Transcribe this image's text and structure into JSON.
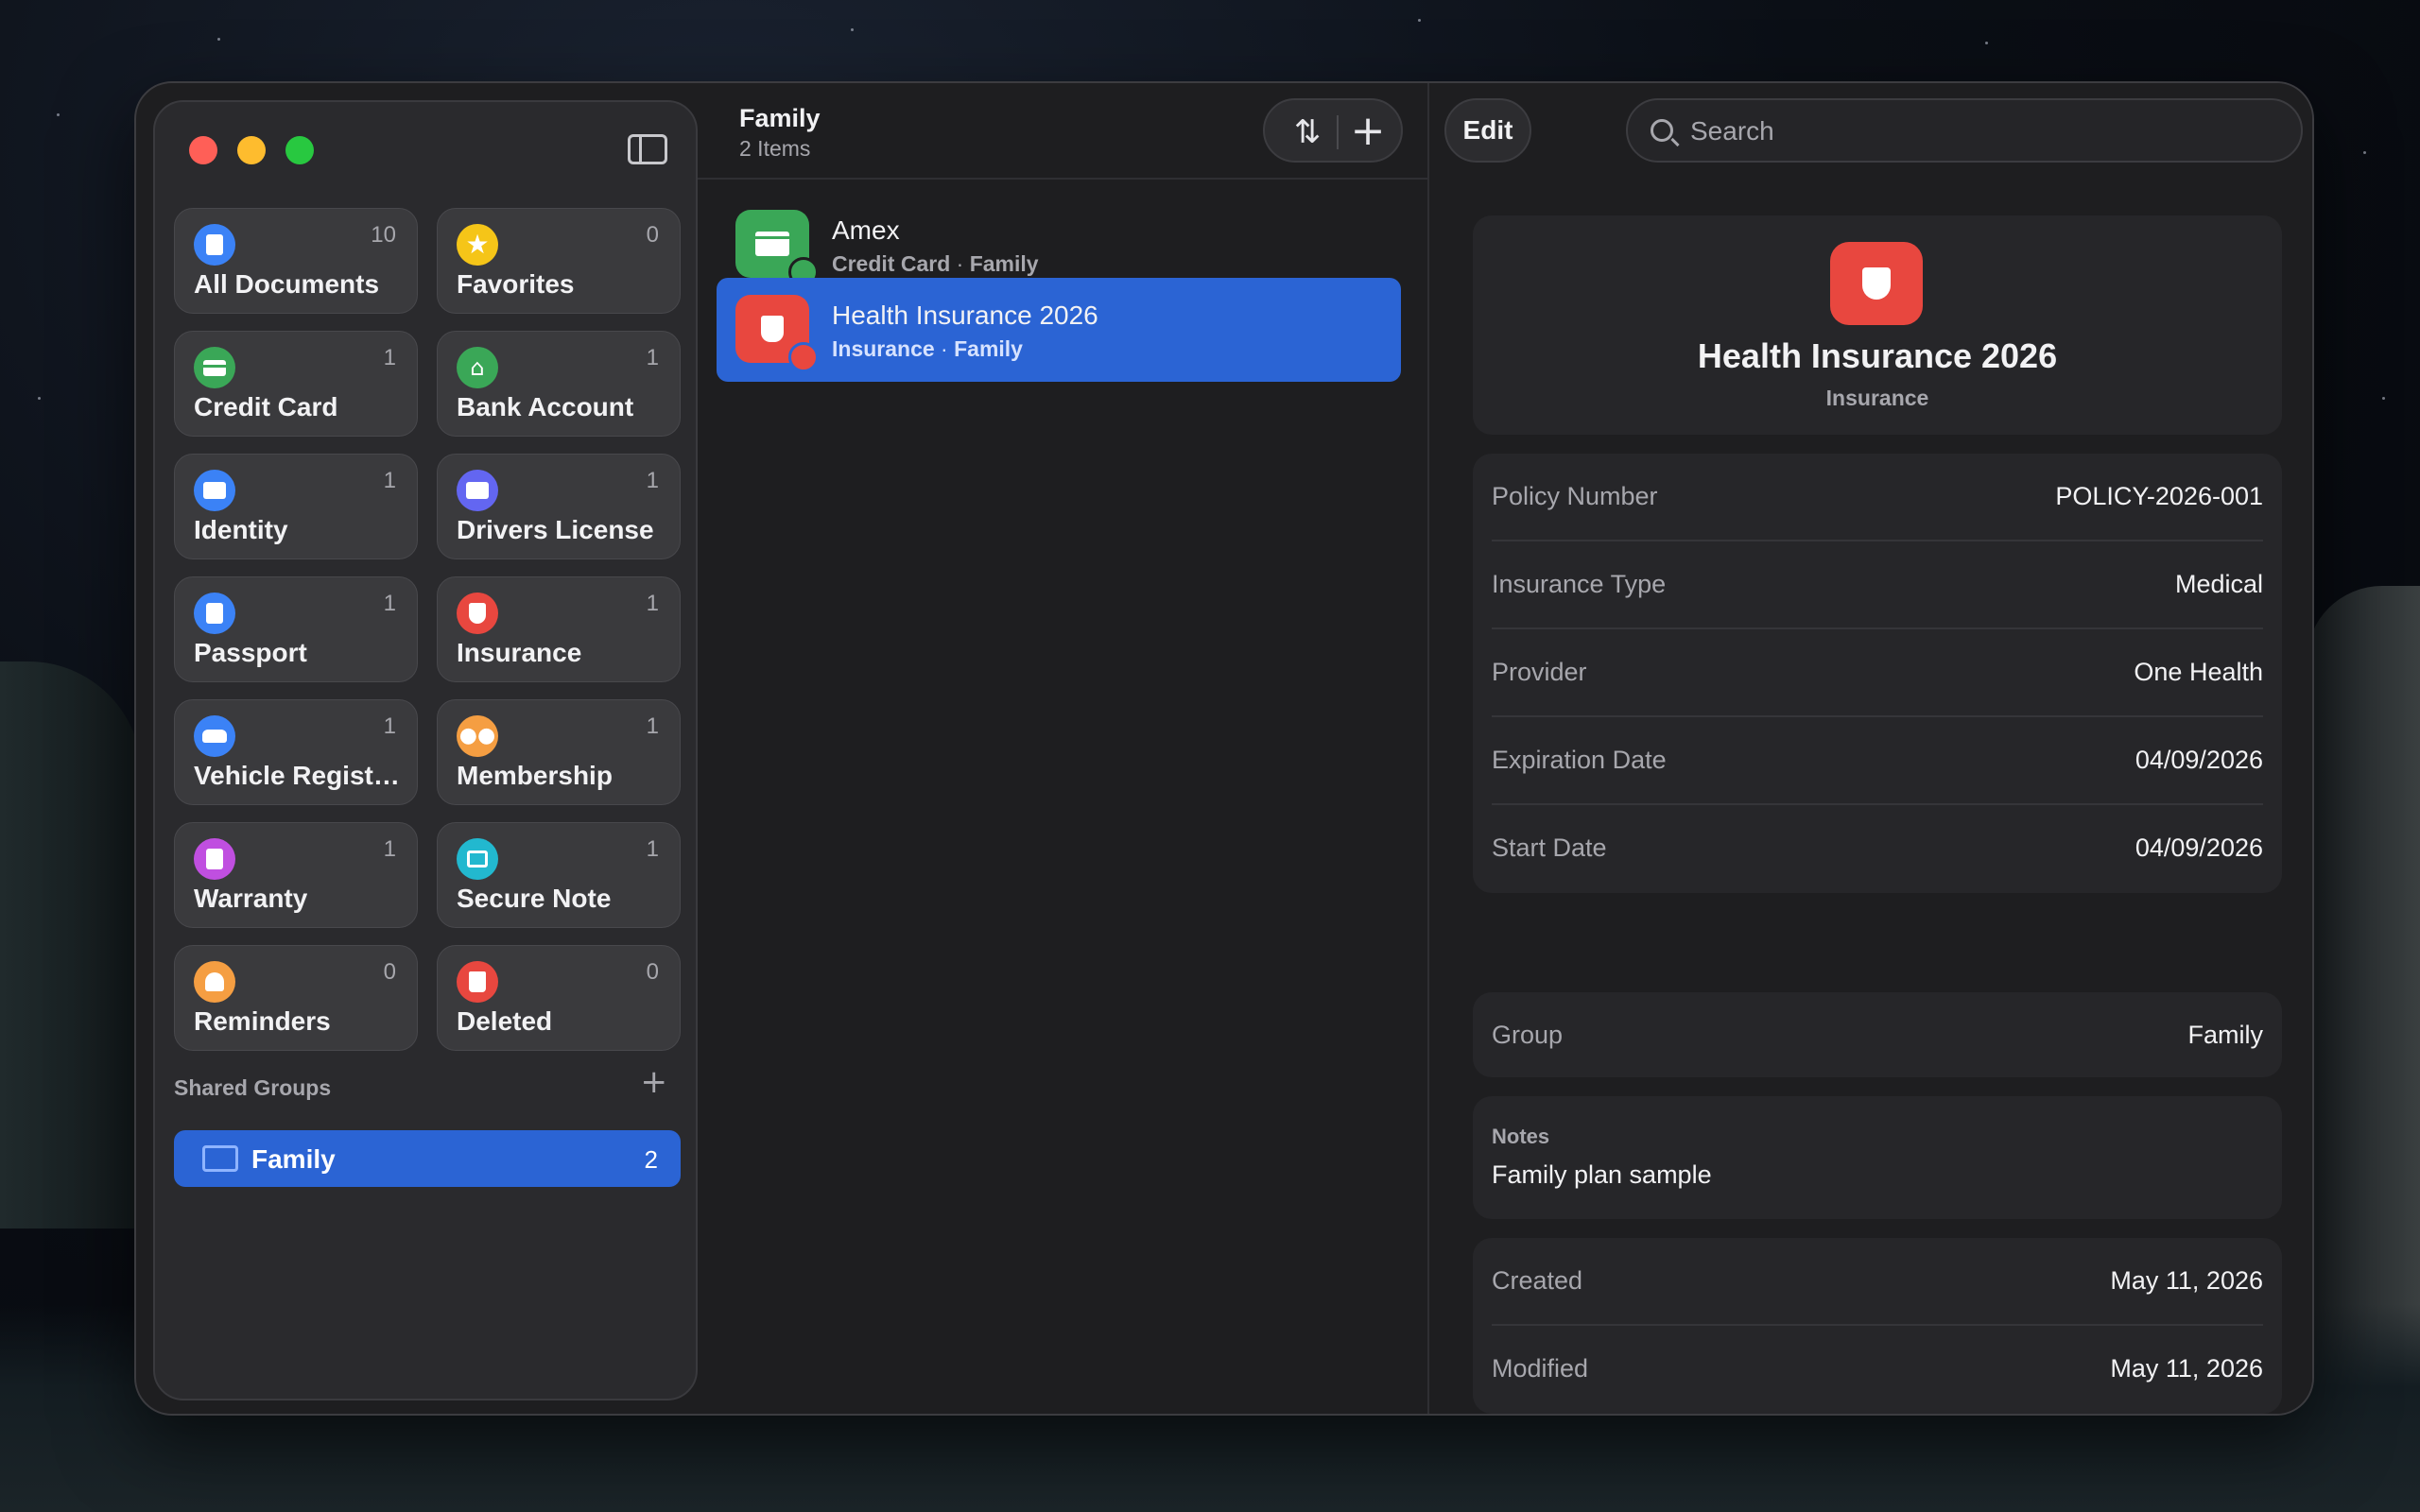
{
  "sidebar": {
    "tiles": [
      {
        "label": "All Documents",
        "count": "10",
        "icon": "document-icon",
        "color": "#3b82f6"
      },
      {
        "label": "Favorites",
        "count": "0",
        "icon": "star-icon",
        "color": "#f5c518"
      },
      {
        "label": "Credit Card",
        "count": "1",
        "icon": "credit-card-icon",
        "color": "#3aa757"
      },
      {
        "label": "Bank Account",
        "count": "1",
        "icon": "bank-icon",
        "color": "#3aa757"
      },
      {
        "label": "Identity",
        "count": "1",
        "icon": "id-card-icon",
        "color": "#3b82f6"
      },
      {
        "label": "Drivers License",
        "count": "1",
        "icon": "license-icon",
        "color": "#6366f1"
      },
      {
        "label": "Passport",
        "count": "1",
        "icon": "passport-icon",
        "color": "#3b82f6"
      },
      {
        "label": "Insurance",
        "count": "1",
        "icon": "shield-icon",
        "color": "#e8473f"
      },
      {
        "label": "Vehicle Registration",
        "count": "1",
        "icon": "car-icon",
        "color": "#3b82f6"
      },
      {
        "label": "Membership",
        "count": "1",
        "icon": "people-icon",
        "color": "#f59e42"
      },
      {
        "label": "Warranty",
        "count": "1",
        "icon": "warranty-icon",
        "color": "#c04fe0"
      },
      {
        "label": "Secure Note",
        "count": "1",
        "icon": "note-icon",
        "color": "#22b8cf"
      },
      {
        "label": "Reminders",
        "count": "0",
        "icon": "bell-icon",
        "color": "#f59e42"
      },
      {
        "label": "Deleted",
        "count": "0",
        "icon": "trash-icon",
        "color": "#e8473f"
      }
    ],
    "shared_groups_title": "Shared Groups",
    "groups": [
      {
        "name": "Family",
        "count": "2"
      }
    ]
  },
  "list": {
    "title": "Family",
    "subtitle": "2 Items",
    "items": [
      {
        "name": "Amex",
        "type": "Credit Card",
        "group": "Family",
        "color": "#3aa757",
        "selected": false
      },
      {
        "name": "Health Insurance 2026",
        "type": "Insurance",
        "group": "Family",
        "color": "#e8473f",
        "selected": true
      }
    ]
  },
  "detail": {
    "edit_label": "Edit",
    "search_placeholder": "Search",
    "title": "Health Insurance 2026",
    "subtitle": "Insurance",
    "fields": [
      {
        "key": "Policy Number",
        "value": "POLICY-2026-001"
      },
      {
        "key": "Insurance Type",
        "value": "Medical"
      },
      {
        "key": "Provider",
        "value": "One Health"
      },
      {
        "key": "Expiration Date",
        "value": "04/09/2026"
      },
      {
        "key": "Start Date",
        "value": "04/09/2026"
      }
    ],
    "group": {
      "key": "Group",
      "value": "Family"
    },
    "notes": {
      "key": "Notes",
      "value": "Family plan sample"
    },
    "dates": [
      {
        "key": "Created",
        "value": "May 11, 2026"
      },
      {
        "key": "Modified",
        "value": "May 11, 2026"
      }
    ]
  }
}
